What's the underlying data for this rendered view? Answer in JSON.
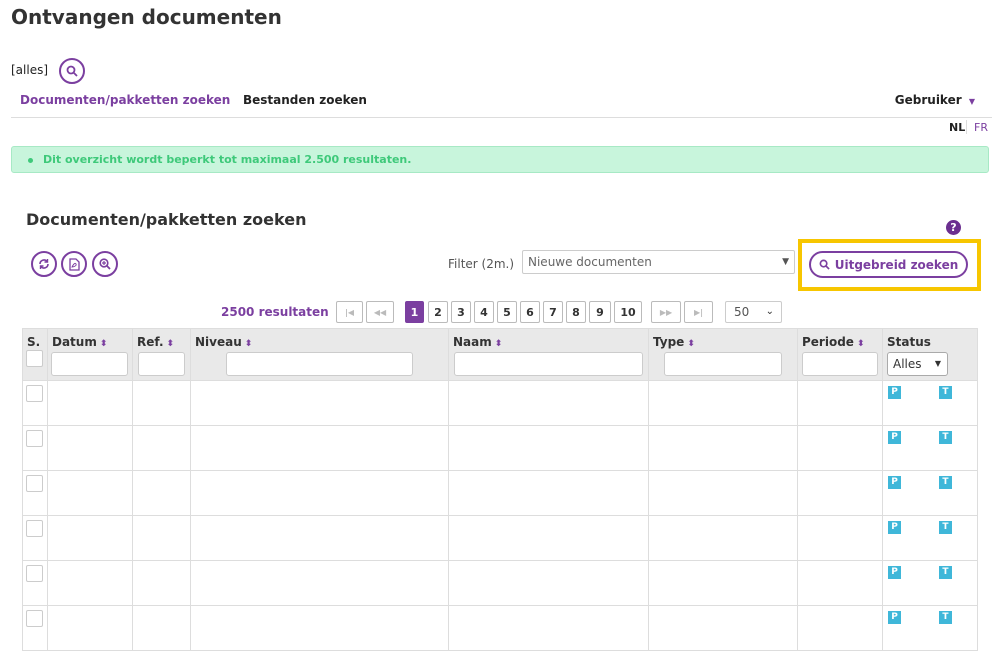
{
  "page": {
    "title": "Ontvangen documenten",
    "scope": "[alles]"
  },
  "nav": {
    "tabs": [
      {
        "label": "Documenten/pakketten zoeken",
        "active": true
      },
      {
        "label": "Bestanden zoeken",
        "active": false
      }
    ],
    "user_menu": "Gebruiker"
  },
  "languages": [
    {
      "label": "NL",
      "active": true
    },
    {
      "label": "FR",
      "active": false
    }
  ],
  "alert": {
    "text": "Dit overzicht wordt beperkt tot maximaal 2.500 resultaten."
  },
  "section": {
    "title": "Documenten/pakketten zoeken"
  },
  "filter": {
    "label": "Filter (2m.)",
    "value": "Nieuwe documenten"
  },
  "advanced_search": {
    "label": "Uitgebreid zoeken"
  },
  "pagination": {
    "results": "2500 resultaten",
    "pages": [
      "1",
      "2",
      "3",
      "4",
      "5",
      "6",
      "7",
      "8",
      "9",
      "10"
    ],
    "current": "1",
    "per_page": "50"
  },
  "table": {
    "columns": [
      "S.",
      "Datum",
      "Ref.",
      "Niveau",
      "Naam",
      "Type",
      "Periode",
      "Status"
    ],
    "status_filter": "Alles",
    "badges": [
      "P",
      "T"
    ],
    "row_count": 6
  },
  "colors": {
    "accent": "#7b3fa0",
    "alert_bg": "#c8f5dc",
    "alert_text": "#3ec97a",
    "badge": "#3fb7d9",
    "highlight": "#f7c600"
  }
}
